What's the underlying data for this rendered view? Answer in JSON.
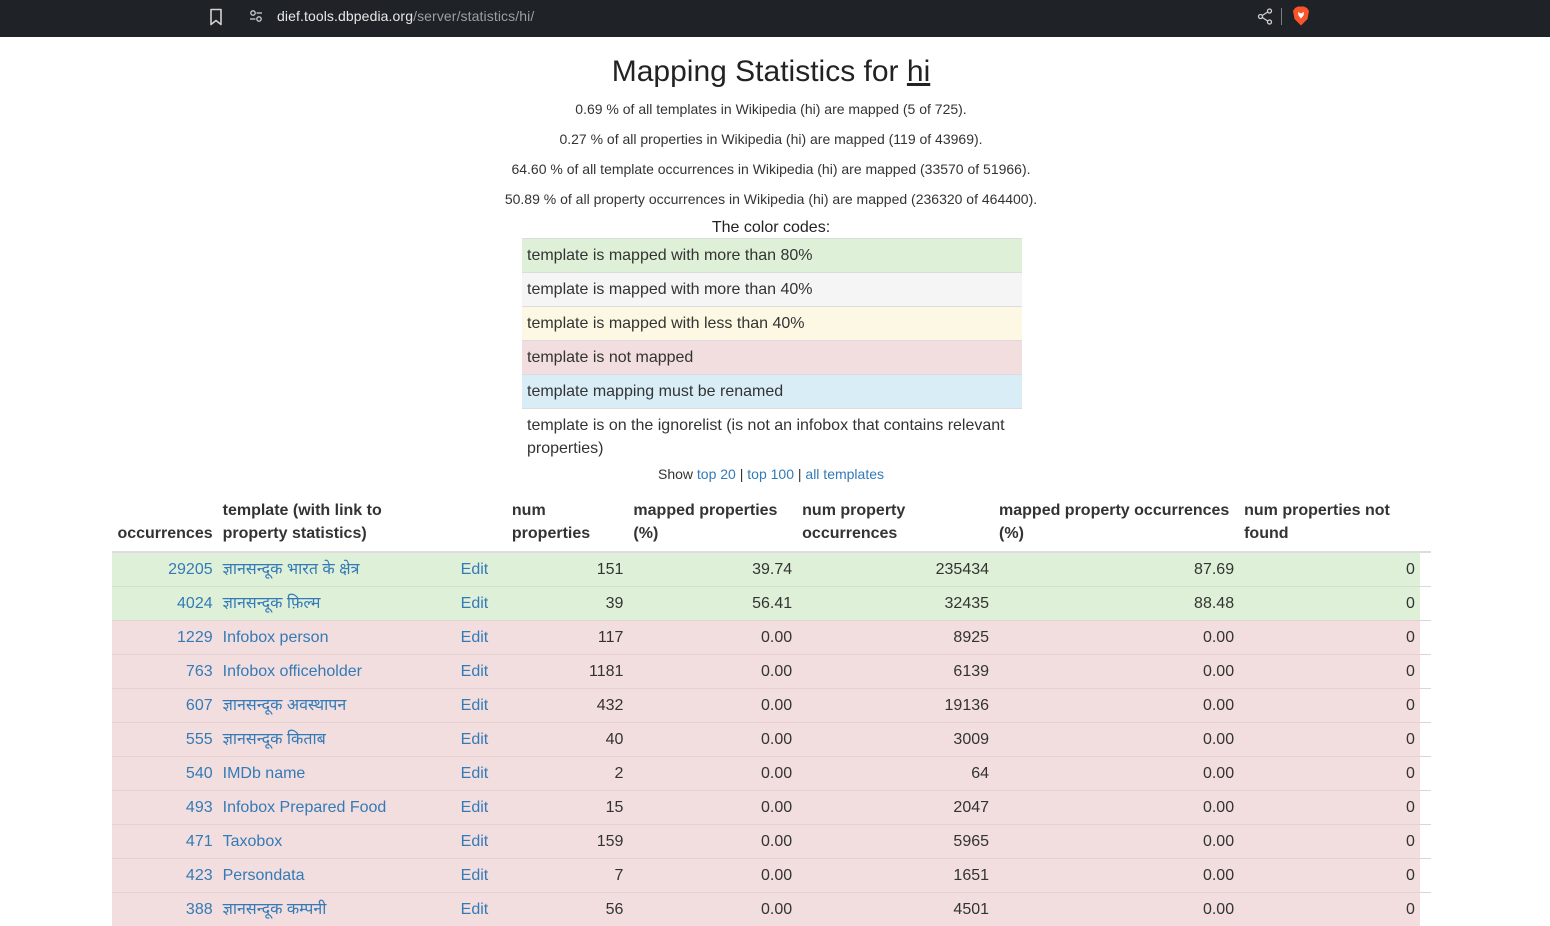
{
  "browser": {
    "url_host": "dief.tools.dbpedia.org",
    "url_path": "/server/statistics/hi/"
  },
  "page": {
    "title_prefix": "Mapping Statistics for",
    "title_lang": "hi",
    "stats": [
      "0.69 % of all templates in Wikipedia (hi) are mapped (5 of 725).",
      "0.27 % of all properties in Wikipedia (hi) are mapped (119 of 43969).",
      "64.60 % of all template occurrences in Wikipedia (hi) are mapped (33570 of 51966).",
      "50.89 % of all property occurrences in Wikipedia (hi) are mapped (236320 of 464400)."
    ],
    "color_codes_title": "The color codes:",
    "legend": [
      "template is mapped with more than 80%",
      "template is mapped with more than 40%",
      "template is mapped with less than 40%",
      "template is not mapped",
      "template mapping must be renamed",
      "template is on the ignorelist (is not an infobox that contains relevant properties)"
    ],
    "show_label": "Show",
    "show_links": [
      "top 20",
      "top 100",
      "all templates"
    ],
    "show_sep": "|"
  },
  "table": {
    "headers": [
      "occurrences",
      "template (with link to property statistics)",
      "num properties",
      "mapped properties (%)",
      "num property occurrences",
      "mapped property occurrences (%)",
      "num properties not found"
    ],
    "edit_label": "Edit",
    "rows": [
      {
        "occ": "29205",
        "template": "ज्ञानसन्दूक भारत के क्षेत्र",
        "num_props": "151",
        "mapped_pct": "39.74",
        "prop_occ": "235434",
        "mapped_occ_pct": "87.69",
        "not_found": "0",
        "status": "green"
      },
      {
        "occ": "4024",
        "template": "ज्ञानसन्दूक फ़िल्म",
        "num_props": "39",
        "mapped_pct": "56.41",
        "prop_occ": "32435",
        "mapped_occ_pct": "88.48",
        "not_found": "0",
        "status": "green"
      },
      {
        "occ": "1229",
        "template": "Infobox person",
        "num_props": "117",
        "mapped_pct": "0.00",
        "prop_occ": "8925",
        "mapped_occ_pct": "0.00",
        "not_found": "0",
        "status": "red"
      },
      {
        "occ": "763",
        "template": "Infobox officeholder",
        "num_props": "1181",
        "mapped_pct": "0.00",
        "prop_occ": "6139",
        "mapped_occ_pct": "0.00",
        "not_found": "0",
        "status": "red"
      },
      {
        "occ": "607",
        "template": "ज्ञानसन्दूक अवस्थापन",
        "num_props": "432",
        "mapped_pct": "0.00",
        "prop_occ": "19136",
        "mapped_occ_pct": "0.00",
        "not_found": "0",
        "status": "red"
      },
      {
        "occ": "555",
        "template": "ज्ञानसन्दूक किताब",
        "num_props": "40",
        "mapped_pct": "0.00",
        "prop_occ": "3009",
        "mapped_occ_pct": "0.00",
        "not_found": "0",
        "status": "red"
      },
      {
        "occ": "540",
        "template": "IMDb name",
        "num_props": "2",
        "mapped_pct": "0.00",
        "prop_occ": "64",
        "mapped_occ_pct": "0.00",
        "not_found": "0",
        "status": "red"
      },
      {
        "occ": "493",
        "template": "Infobox Prepared Food",
        "num_props": "15",
        "mapped_pct": "0.00",
        "prop_occ": "2047",
        "mapped_occ_pct": "0.00",
        "not_found": "0",
        "status": "red"
      },
      {
        "occ": "471",
        "template": "Taxobox",
        "num_props": "159",
        "mapped_pct": "0.00",
        "prop_occ": "5965",
        "mapped_occ_pct": "0.00",
        "not_found": "0",
        "status": "red"
      },
      {
        "occ": "423",
        "template": "Persondata",
        "num_props": "7",
        "mapped_pct": "0.00",
        "prop_occ": "1651",
        "mapped_occ_pct": "0.00",
        "not_found": "0",
        "status": "red"
      },
      {
        "occ": "388",
        "template": "ज्ञानसन्दूक कम्पनी",
        "num_props": "56",
        "mapped_pct": "0.00",
        "prop_occ": "4501",
        "mapped_occ_pct": "0.00",
        "not_found": "0",
        "status": "red"
      }
    ]
  }
}
